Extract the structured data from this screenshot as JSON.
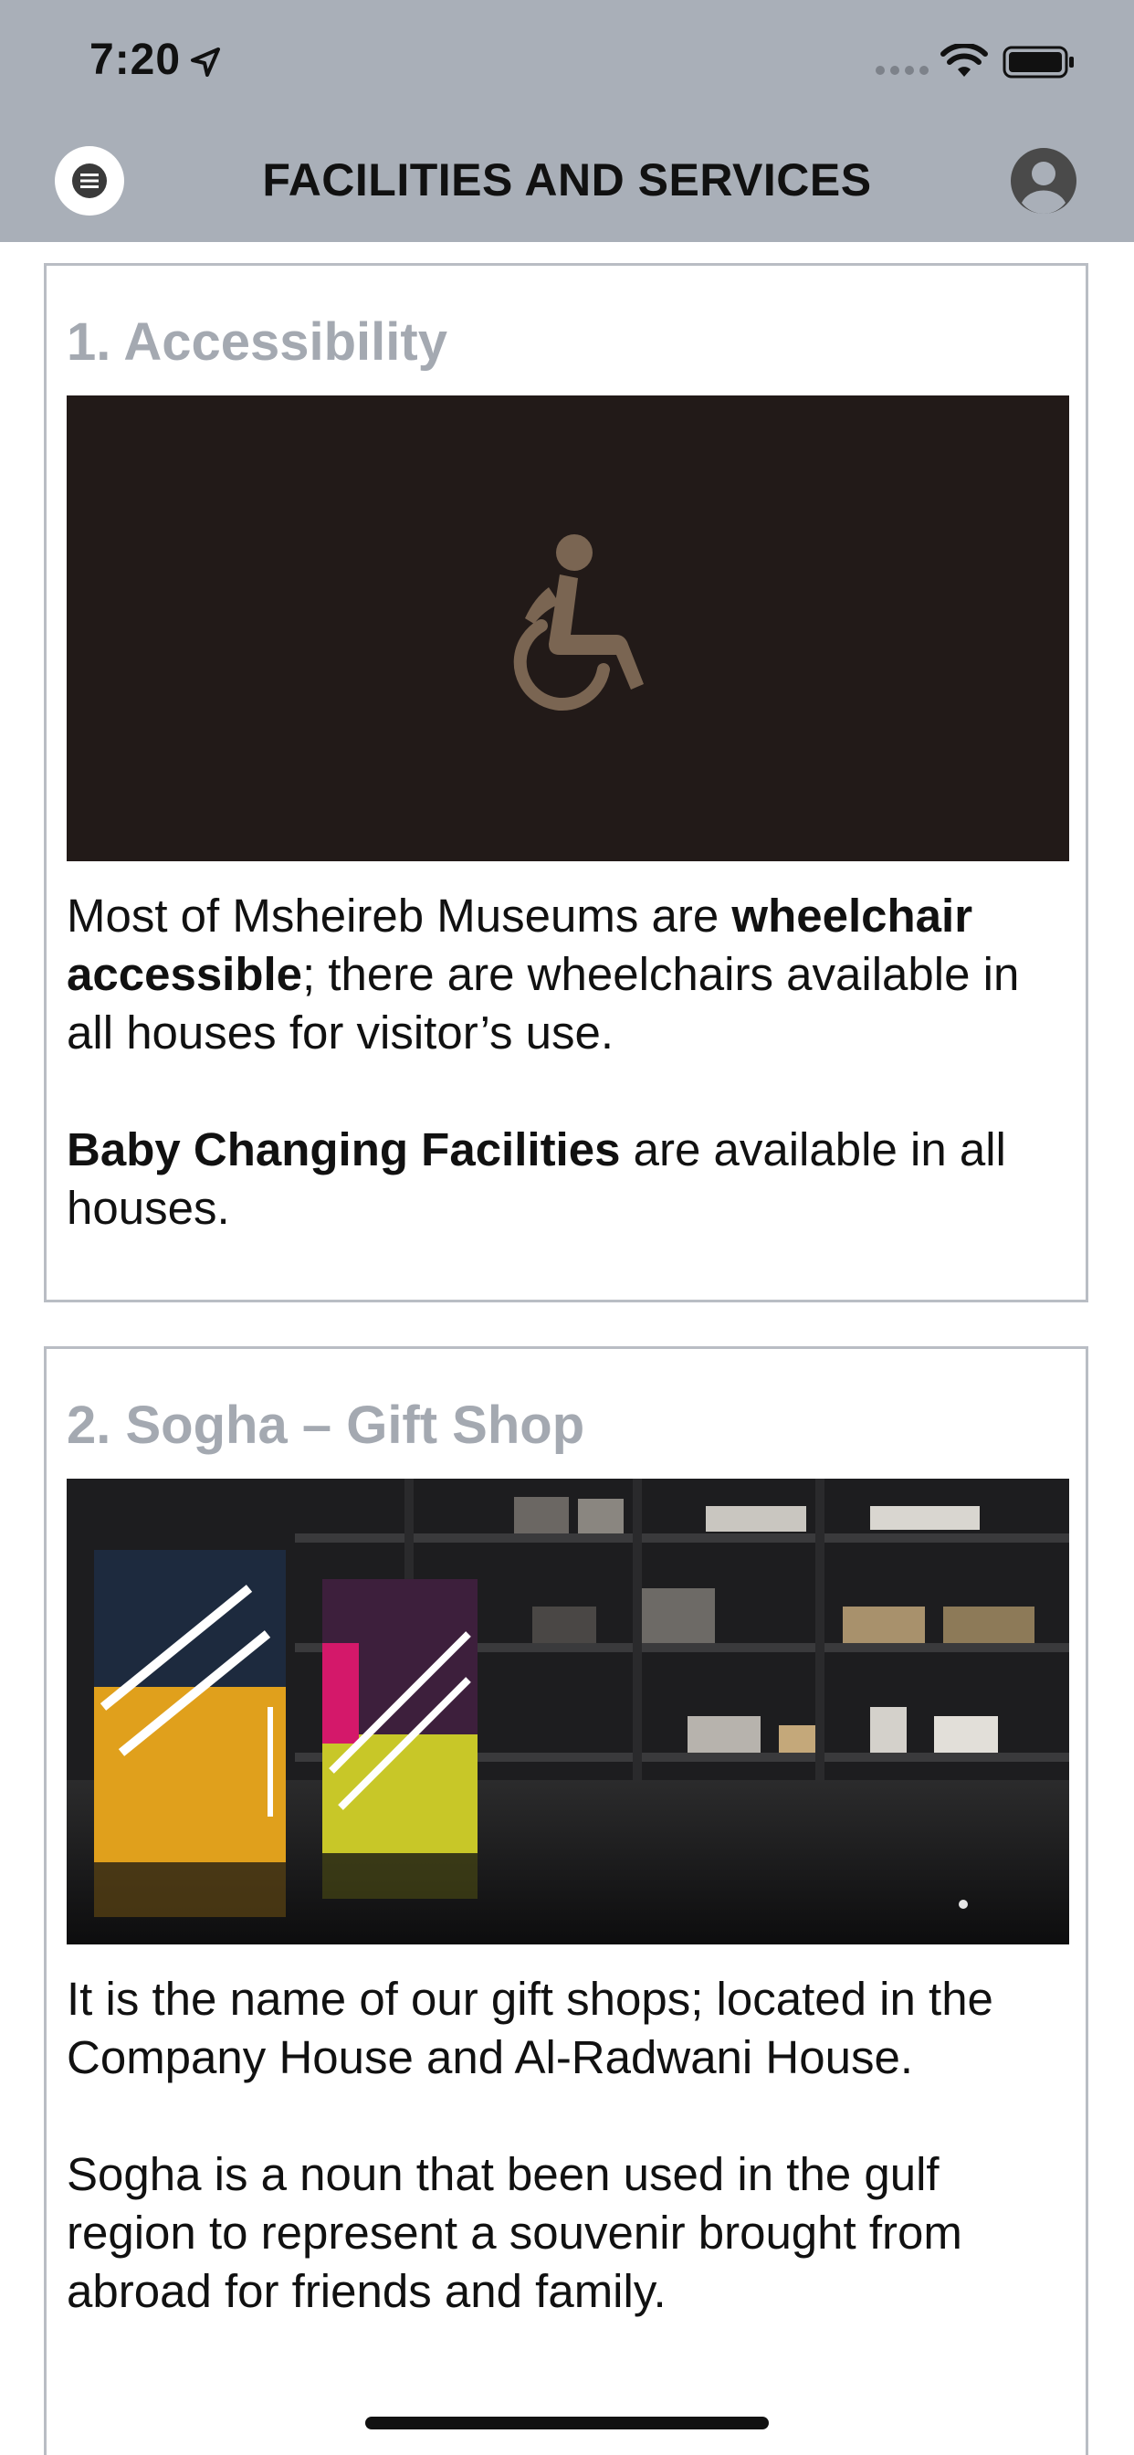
{
  "status_bar": {
    "time": "7:20"
  },
  "nav": {
    "title": "FACILITIES AND SERVICES",
    "menu_icon": "hamburger-menu-icon",
    "profile_icon": "user-avatar-icon"
  },
  "sections": [
    {
      "title": "1. Accessibility",
      "image": "wheelchair-accessibility-icon",
      "p1_pre": "Most of Msheireb Museums are ",
      "p1_bold": "wheelchair accessible",
      "p1_post": "; there are wheelchairs available in all houses for visitor’s use.",
      "p2_bold": "Baby Changing Facilities",
      "p2_post": " are available in all houses."
    },
    {
      "title": "2. Sogha – Gift Shop",
      "image": "gift-shop-photo",
      "p1": "It is the name of our gift shops; located in the Company House and Al-Radwani House.",
      "p2": "Sogha is a noun that been used in the gulf region to represent a souvenir brought from abroad for friends and family."
    }
  ],
  "colors": {
    "header_bg": "#a9afb8",
    "section_title": "#a4a9b1",
    "card_border": "#b9bdc4",
    "accessibility_bg": "#221a18",
    "accessibility_icon": "#7a6552"
  }
}
